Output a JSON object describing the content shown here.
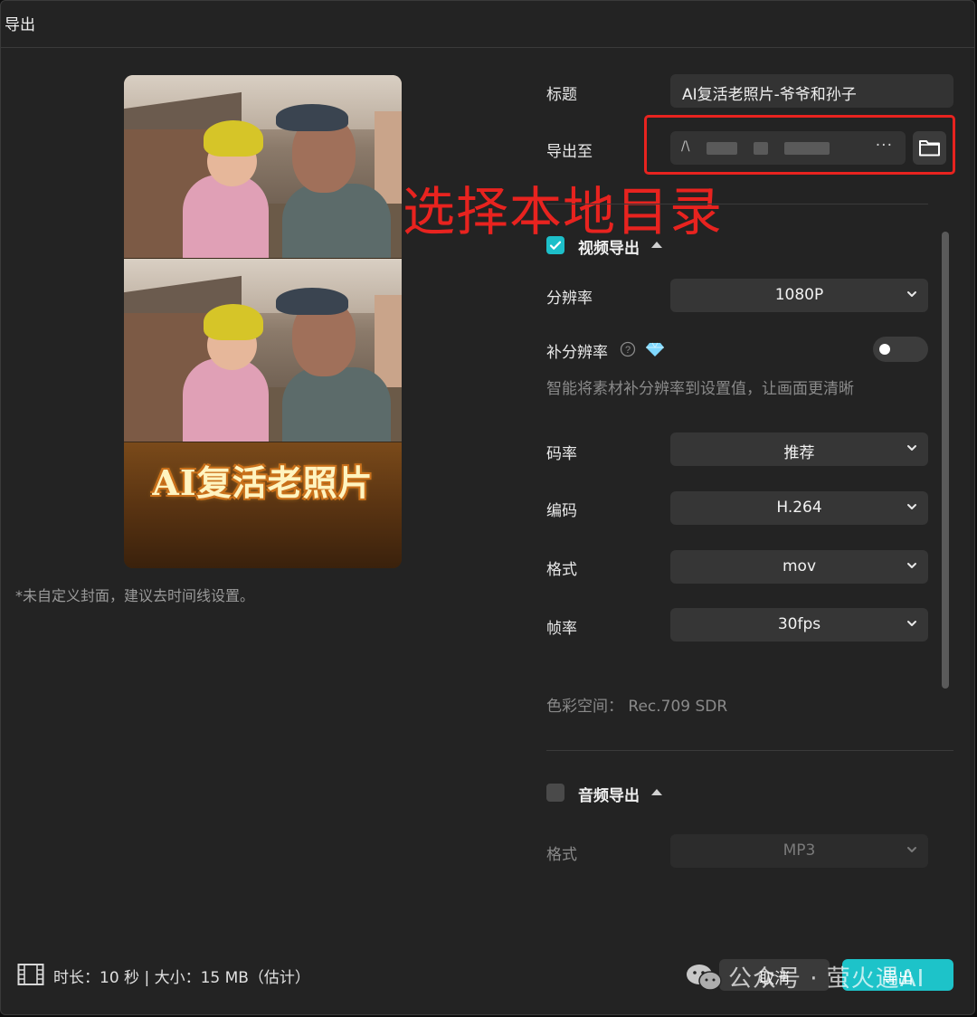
{
  "dialog": {
    "title": "导出"
  },
  "preview": {
    "banner_text": "AI复活老照片",
    "cover_hint": "*未自定义封面，建议去时间线设置。"
  },
  "form": {
    "title_label": "标题",
    "title_value": "AI复活老照片-爷爷和孙子",
    "export_to_label": "导出至",
    "export_path_prefix": "/\\",
    "export_path_more": "···",
    "annotation": "选择本地目录"
  },
  "video": {
    "section_title": "视频导出",
    "checked": true,
    "resolution_label": "分辨率",
    "resolution_value": "1080P",
    "upscale_label": "补分辨率",
    "upscale_enabled": false,
    "upscale_desc": "智能将素材补分辨率到设置值，让画面更清晰",
    "bitrate_label": "码率",
    "bitrate_value": "推荐",
    "codec_label": "编码",
    "codec_value": "H.264",
    "format_label": "格式",
    "format_value": "mov",
    "fps_label": "帧率",
    "fps_value": "30fps",
    "color_space": "色彩空间： Rec.709 SDR"
  },
  "audio": {
    "section_title": "音频导出",
    "checked": false,
    "format_label": "格式",
    "format_value": "MP3"
  },
  "footer": {
    "info": "时长：10 秒 | 大小：15 MB（估计）",
    "cancel_label": "取消",
    "export_label": "导出",
    "watermark": "公众号 · 萤火遇AI"
  },
  "colors": {
    "accent": "#1dc3c9",
    "annotation_red": "#e8231f",
    "background": "#232323"
  }
}
